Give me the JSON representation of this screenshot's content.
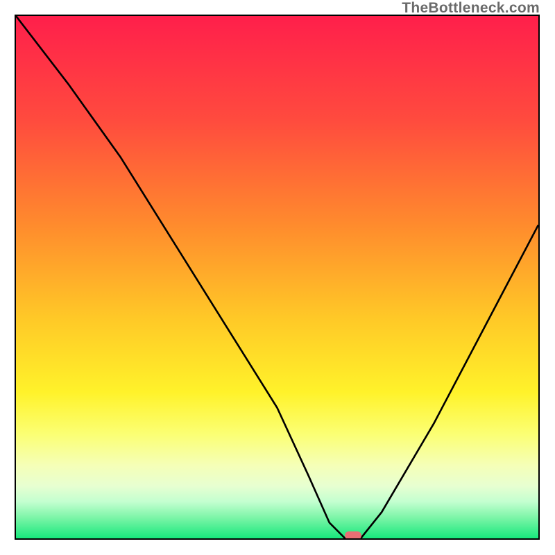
{
  "attribution": "TheBottleneck.com",
  "chart_data": {
    "type": "line",
    "title": "",
    "xlabel": "",
    "ylabel": "",
    "xlim": [
      0,
      100
    ],
    "ylim": [
      0,
      100
    ],
    "series": [
      {
        "name": "bottleneck-curve",
        "x": [
          0,
          10,
          20,
          30,
          40,
          50,
          56,
          60,
          63,
          66,
          70,
          80,
          90,
          100
        ],
        "y": [
          100,
          87,
          73,
          57,
          41,
          25,
          12,
          3,
          0,
          0,
          5,
          22,
          41,
          60
        ]
      }
    ],
    "marker": {
      "x": 64.5,
      "y": 0.5
    },
    "gradient_stops": [
      {
        "pos": 0,
        "color": "#ff1f4b"
      },
      {
        "pos": 20,
        "color": "#ff4b3e"
      },
      {
        "pos": 40,
        "color": "#ff8b2d"
      },
      {
        "pos": 58,
        "color": "#ffc927"
      },
      {
        "pos": 72,
        "color": "#fff22a"
      },
      {
        "pos": 80,
        "color": "#fbff73"
      },
      {
        "pos": 86,
        "color": "#f5ffb7"
      },
      {
        "pos": 90,
        "color": "#e7ffd1"
      },
      {
        "pos": 93,
        "color": "#c3ffd0"
      },
      {
        "pos": 96,
        "color": "#7df5a8"
      },
      {
        "pos": 100,
        "color": "#17e87c"
      }
    ]
  }
}
